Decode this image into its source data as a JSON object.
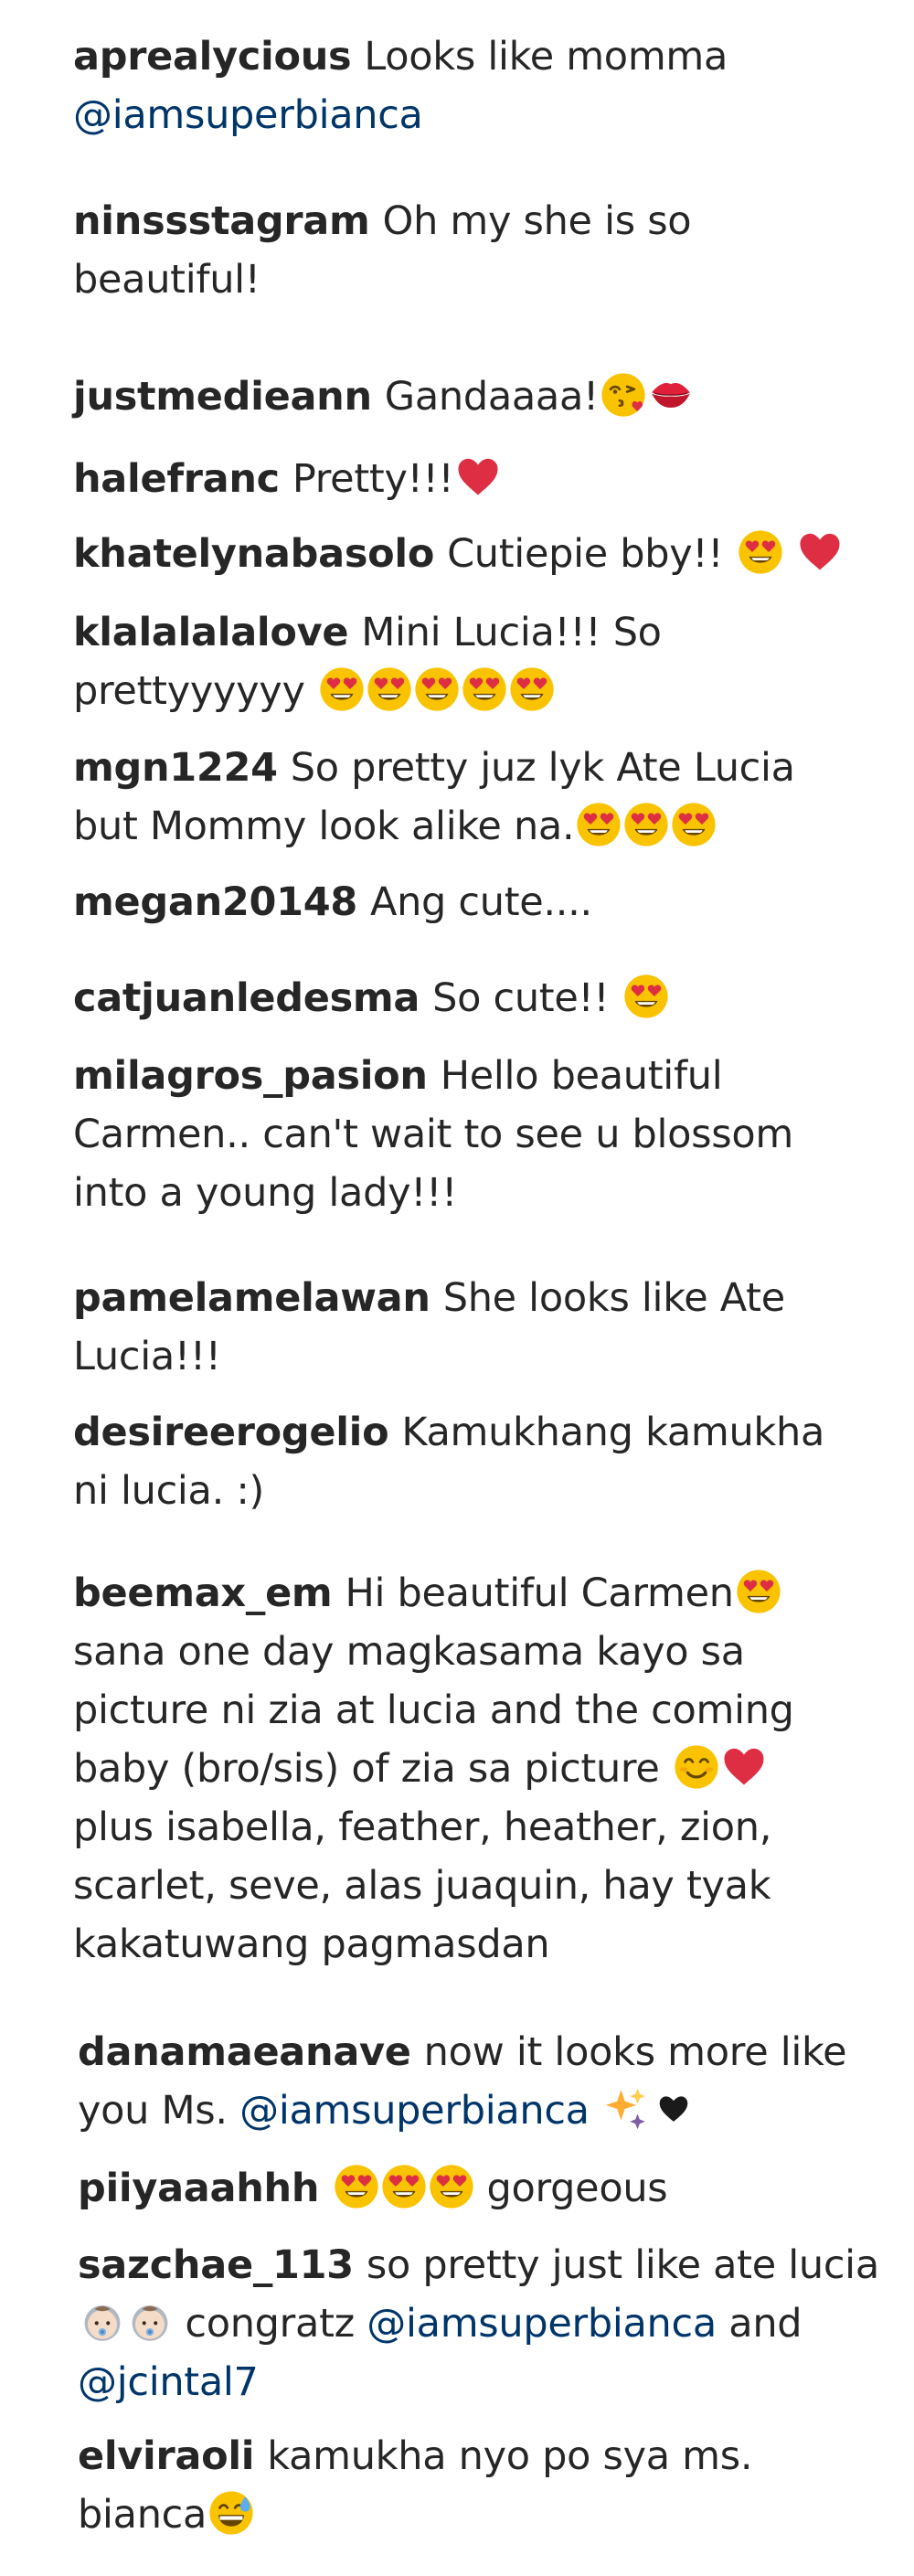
{
  "colors": {
    "text": "#262626",
    "mention": "#003569",
    "emoji_face": "#F9C300",
    "heart": "#DD2E44"
  },
  "comments": [
    {
      "username": "aprealycious",
      "parts": [
        {
          "t": "text",
          "v": "Looks like momma"
        },
        {
          "t": "br"
        },
        {
          "t": "mention",
          "v": "@iamsuperbianca"
        }
      ]
    },
    {
      "username": "ninssstagram",
      "parts": [
        {
          "t": "text",
          "v": "Oh my she is so"
        },
        {
          "t": "br"
        },
        {
          "t": "text",
          "v": "beautiful!"
        }
      ]
    },
    {
      "username": "justmedieann",
      "parts": [
        {
          "t": "text",
          "v": "Gandaaaa!"
        },
        {
          "t": "emoji",
          "v": "face-blowing-kiss-icon"
        },
        {
          "t": "emoji",
          "v": "kiss-mark-icon"
        }
      ]
    },
    {
      "username": "halefranc",
      "parts": [
        {
          "t": "text",
          "v": "Pretty!!!"
        },
        {
          "t": "emoji",
          "v": "red-heart-icon"
        }
      ]
    },
    {
      "username": "khatelynabasolo",
      "parts": [
        {
          "t": "text",
          "v": "Cutiepie bby!! "
        },
        {
          "t": "emoji",
          "v": "heart-eyes-icon"
        },
        {
          "t": "text",
          "v": " "
        },
        {
          "t": "emoji",
          "v": "red-heart-icon"
        }
      ]
    },
    {
      "username": "klalalalalove",
      "parts": [
        {
          "t": "text",
          "v": "Mini Lucia!!! So"
        },
        {
          "t": "br"
        },
        {
          "t": "text",
          "v": "prettyyyyyy "
        },
        {
          "t": "emoji",
          "v": "heart-eyes-icon"
        },
        {
          "t": "emoji",
          "v": "heart-eyes-icon"
        },
        {
          "t": "emoji",
          "v": "heart-eyes-icon"
        },
        {
          "t": "emoji",
          "v": "heart-eyes-icon"
        },
        {
          "t": "emoji",
          "v": "heart-eyes-icon"
        }
      ]
    },
    {
      "username": "mgn1224",
      "parts": [
        {
          "t": "text",
          "v": "So pretty juz lyk Ate Lucia"
        },
        {
          "t": "br"
        },
        {
          "t": "text",
          "v": "but Mommy look alike na."
        },
        {
          "t": "emoji",
          "v": "heart-eyes-icon"
        },
        {
          "t": "emoji",
          "v": "heart-eyes-icon"
        },
        {
          "t": "emoji",
          "v": "heart-eyes-icon"
        }
      ]
    },
    {
      "username": "megan20148",
      "parts": [
        {
          "t": "text",
          "v": "Ang cute...."
        }
      ]
    },
    {
      "username": "catjuanledesma",
      "parts": [
        {
          "t": "text",
          "v": "So cute!! "
        },
        {
          "t": "emoji",
          "v": "heart-eyes-icon"
        }
      ]
    },
    {
      "username": "milagros_pasion",
      "parts": [
        {
          "t": "text",
          "v": "Hello beautiful"
        },
        {
          "t": "br"
        },
        {
          "t": "text",
          "v": "Carmen.. can't wait to see u blossom"
        },
        {
          "t": "br"
        },
        {
          "t": "text",
          "v": "into a young lady!!!"
        }
      ]
    },
    {
      "username": "pamelamelawan",
      "parts": [
        {
          "t": "text",
          "v": "She looks like Ate"
        },
        {
          "t": "br"
        },
        {
          "t": "text",
          "v": "Lucia!!!"
        }
      ]
    },
    {
      "username": "desireerogelio",
      "parts": [
        {
          "t": "text",
          "v": "Kamukhang kamukha"
        },
        {
          "t": "br"
        },
        {
          "t": "text",
          "v": "ni lucia. :)"
        }
      ]
    },
    {
      "username": "beemax_em",
      "parts": [
        {
          "t": "text",
          "v": "Hi beautiful Carmen"
        },
        {
          "t": "emoji",
          "v": "heart-eyes-icon"
        },
        {
          "t": "br"
        },
        {
          "t": "text",
          "v": "sana one day magkasama kayo sa"
        },
        {
          "t": "br"
        },
        {
          "t": "text",
          "v": "picture ni zia at lucia and the coming"
        },
        {
          "t": "br"
        },
        {
          "t": "text",
          "v": "baby (bro/sis) of zia sa picture "
        },
        {
          "t": "emoji",
          "v": "smiling-face-icon"
        },
        {
          "t": "emoji",
          "v": "red-heart-icon"
        },
        {
          "t": "br"
        },
        {
          "t": "text",
          "v": "plus isabella, feather, heather, zion,"
        },
        {
          "t": "br"
        },
        {
          "t": "text",
          "v": "scarlet, seve, alas juaquin, hay tyak"
        },
        {
          "t": "br"
        },
        {
          "t": "text",
          "v": "kakatuwang pagmasdan"
        }
      ]
    },
    {
      "username": "danamaeanave",
      "parts": [
        {
          "t": "text",
          "v": "now it looks more like"
        },
        {
          "t": "br"
        },
        {
          "t": "text",
          "v": "you Ms. "
        },
        {
          "t": "mention",
          "v": "@iamsuperbianca"
        },
        {
          "t": "text",
          "v": " "
        },
        {
          "t": "emoji",
          "v": "sparkles-icon"
        },
        {
          "t": "emoji",
          "v": "black-heart-icon"
        }
      ]
    },
    {
      "username": "piiyaaahhh",
      "parts": [
        {
          "t": "emoji",
          "v": "heart-eyes-icon"
        },
        {
          "t": "emoji",
          "v": "heart-eyes-icon"
        },
        {
          "t": "emoji",
          "v": "heart-eyes-icon"
        },
        {
          "t": "text",
          "v": " gorgeous"
        }
      ]
    },
    {
      "username": "sazchae_113",
      "parts": [
        {
          "t": "text",
          "v": "so pretty just like ate lucia"
        },
        {
          "t": "br"
        },
        {
          "t": "emoji",
          "v": "baby-icon"
        },
        {
          "t": "emoji",
          "v": "baby-icon"
        },
        {
          "t": "text",
          "v": " congratz "
        },
        {
          "t": "mention",
          "v": "@iamsuperbianca"
        },
        {
          "t": "text",
          "v": " and"
        },
        {
          "t": "br"
        },
        {
          "t": "mention",
          "v": "@jcintal7"
        }
      ]
    },
    {
      "username": "elviraoli",
      "parts": [
        {
          "t": "text",
          "v": "kamukha nyo po sya ms."
        },
        {
          "t": "br"
        },
        {
          "t": "text",
          "v": "bianca"
        },
        {
          "t": "emoji",
          "v": "grinning-sweat-icon"
        }
      ]
    }
  ]
}
